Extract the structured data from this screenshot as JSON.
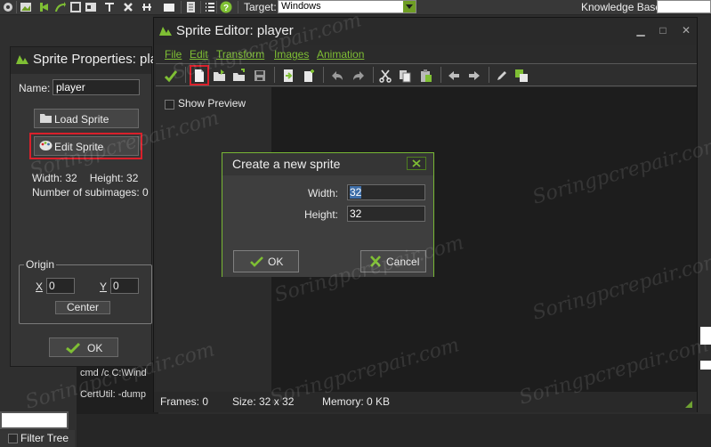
{
  "ide_toolbar": {
    "target_label": "Target:",
    "target_value": "Windows",
    "knowledge_base_label": "Knowledge Base:"
  },
  "filter_tree": {
    "label": "Filter Tree"
  },
  "console": {
    "lines": [
      "cmd /c   C:\\Wind",
      "CertUtil: -dump"
    ]
  },
  "sprite_properties": {
    "title": "Sprite Properties: pla",
    "name_label": "Name:",
    "name_value": "player",
    "load_sprite": "Load Sprite",
    "edit_sprite": "Edit Sprite",
    "width_text": "Width: 32",
    "height_text": "Height: 32",
    "subimages_text": "Number of subimages: 0",
    "origin_label": "Origin",
    "x_label": "X",
    "x_value": "0",
    "y_label": "Y",
    "y_value": "0",
    "center_button": "Center",
    "ok_button": "OK"
  },
  "sprite_editor": {
    "title": "Sprite Editor: player",
    "menu": [
      "File",
      "Edit",
      "Transform",
      "Images",
      "Animation"
    ],
    "show_preview": "Show Preview",
    "status": {
      "frames": "Frames: 0",
      "size": "Size: 32 x 32",
      "memory": "Memory: 0 KB"
    }
  },
  "new_sprite_dialog": {
    "title": "Create a new sprite",
    "width_label": "Width:",
    "width_value": "32",
    "height_label": "Height:",
    "height_value": "32",
    "ok_button": "OK",
    "cancel_button": "Cancel"
  },
  "watermark": "Soringpcrepair.com",
  "colors": {
    "accent_green": "#7fbf34",
    "highlight_red": "#d9202b",
    "selection_blue": "#3e6ea8"
  }
}
